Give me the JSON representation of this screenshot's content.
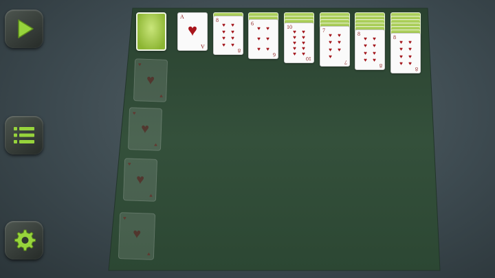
{
  "controls": {
    "play": {
      "icon": "play-icon"
    },
    "menu": {
      "icon": "menu-icon"
    },
    "settings": {
      "icon": "gear-icon"
    }
  },
  "colors": {
    "felt": "#2f4a35",
    "accent": "#8cc43c",
    "heart": "#a8151c",
    "card_back": "#9ec24a"
  },
  "foundations": [
    {
      "suit": "heart",
      "symbol": "♥"
    },
    {
      "suit": "heart",
      "symbol": "♥"
    },
    {
      "suit": "heart",
      "symbol": "♥"
    },
    {
      "suit": "heart",
      "symbol": "♥"
    }
  ],
  "stock": {
    "face": "down"
  },
  "tableau": [
    {
      "hidden": 0,
      "rank": "A",
      "suit": "♥",
      "pips": 1
    },
    {
      "hidden": 1,
      "rank": "8",
      "suit": "♥",
      "pips": 8
    },
    {
      "hidden": 2,
      "rank": "6",
      "suit": "♥",
      "pips": 6
    },
    {
      "hidden": 3,
      "rank": "10",
      "suit": "♥",
      "pips": 10
    },
    {
      "hidden": 4,
      "rank": "7",
      "suit": "♥",
      "pips": 7
    },
    {
      "hidden": 5,
      "rank": "8",
      "suit": "♥",
      "pips": 8
    },
    {
      "hidden": 6,
      "rank": "8",
      "suit": "♥",
      "pips": 8
    }
  ]
}
